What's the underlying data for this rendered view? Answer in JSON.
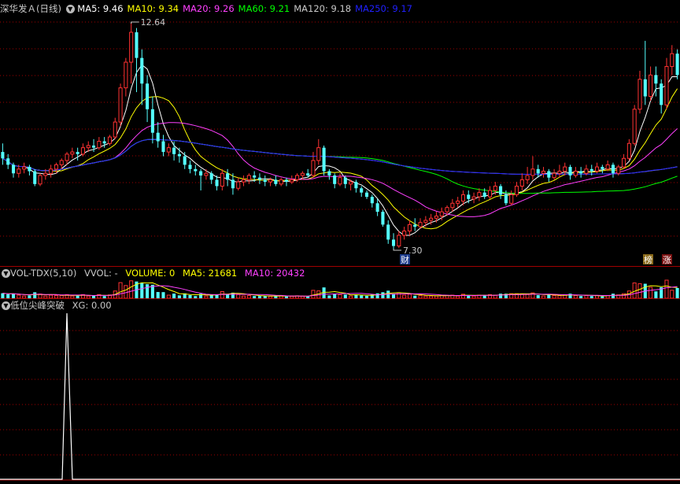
{
  "main_panel": {
    "title": "深华发Ａ(日线)",
    "ma_labels": [
      {
        "text": "MA5: 9.46",
        "color": "#ffffff"
      },
      {
        "text": "MA10: 9.34",
        "color": "#ffff00"
      },
      {
        "text": "MA20: 9.26",
        "color": "#ff40ff"
      },
      {
        "text": "MA60: 9.21",
        "color": "#00ff00"
      },
      {
        "text": "MA120: 9.18",
        "color": "#c8c8c8"
      },
      {
        "text": "MA250: 9.17",
        "color": "#2020ff"
      }
    ],
    "high_label": "12.64",
    "low_label": "7.30",
    "badge_cai": "财",
    "badge_bang": "榜",
    "badge_zhang": "涨"
  },
  "volume_panel": {
    "name": "VOL-TDX(5,10)",
    "vvol": "VVOL: -",
    "volume": "VOLUME: 0",
    "ma5": "MA5: 21681",
    "ma10": "MA10: 20432"
  },
  "signal_panel": {
    "name": "低位尖峰突破",
    "xg": "XG: 0.00"
  },
  "colors": {
    "up": "#ff3232",
    "down": "#54ffff",
    "grid": "#a00000",
    "ma5": "#ffffff",
    "ma10": "#ffff00",
    "ma20": "#ff40ff",
    "ma60": "#00ff00",
    "ma120": "#c8c8c8",
    "ma250": "#2020ff"
  },
  "candles": [
    [
      9.6,
      9.45,
      9.8,
      9.3
    ],
    [
      9.45,
      9.3,
      9.55,
      9.2
    ],
    [
      9.3,
      9.1,
      9.35,
      9.0
    ],
    [
      9.1,
      9.2,
      9.3,
      9.0
    ],
    [
      9.2,
      9.25,
      9.35,
      9.1
    ],
    [
      9.25,
      9.15,
      9.3,
      9.05
    ],
    [
      9.15,
      8.85,
      9.2,
      8.8
    ],
    [
      8.85,
      9.05,
      9.1,
      8.8
    ],
    [
      9.05,
      9.1,
      9.2,
      8.95
    ],
    [
      9.1,
      9.2,
      9.3,
      9.0
    ],
    [
      9.2,
      9.3,
      9.35,
      9.1
    ],
    [
      9.3,
      9.4,
      9.45,
      9.2
    ],
    [
      9.4,
      9.55,
      9.6,
      9.3
    ],
    [
      9.55,
      9.6,
      9.7,
      9.45
    ],
    [
      9.6,
      9.55,
      9.7,
      9.4
    ],
    [
      9.55,
      9.7,
      9.8,
      9.5
    ],
    [
      9.7,
      9.75,
      9.85,
      9.6
    ],
    [
      9.75,
      9.7,
      9.9,
      9.6
    ],
    [
      9.7,
      9.85,
      9.95,
      9.65
    ],
    [
      9.85,
      9.8,
      9.95,
      9.7
    ],
    [
      9.8,
      9.95,
      10.0,
      9.75
    ],
    [
      9.95,
      10.3,
      10.4,
      9.9
    ],
    [
      10.3,
      11.1,
      11.2,
      10.2
    ],
    [
      11.1,
      11.7,
      11.8,
      10.9
    ],
    [
      11.7,
      12.4,
      12.64,
      11.2
    ],
    [
      12.4,
      11.8,
      12.5,
      11.0
    ],
    [
      11.8,
      11.2,
      12.0,
      10.7
    ],
    [
      11.2,
      10.6,
      11.4,
      10.3
    ],
    [
      10.6,
      10.05,
      10.9,
      9.8
    ],
    [
      10.05,
      9.85,
      10.3,
      9.7
    ],
    [
      9.85,
      9.6,
      10.0,
      9.5
    ],
    [
      9.6,
      9.7,
      9.8,
      9.5
    ],
    [
      9.7,
      9.55,
      9.85,
      9.4
    ],
    [
      9.55,
      9.5,
      9.7,
      9.35
    ],
    [
      9.5,
      9.3,
      9.6,
      9.2
    ],
    [
      9.3,
      9.2,
      9.4,
      9.1
    ],
    [
      9.2,
      9.15,
      9.3,
      9.05
    ],
    [
      9.15,
      9.05,
      9.2,
      8.7
    ],
    [
      9.05,
      9.1,
      9.2,
      8.95
    ],
    [
      9.1,
      8.95,
      9.15,
      8.85
    ],
    [
      8.95,
      8.8,
      9.05,
      8.7
    ],
    [
      8.8,
      9.1,
      9.2,
      8.7
    ],
    [
      9.1,
      8.95,
      9.2,
      8.8
    ],
    [
      8.95,
      8.75,
      9.1,
      8.6
    ],
    [
      8.75,
      8.9,
      9.0,
      8.7
    ],
    [
      8.9,
      8.95,
      9.05,
      8.8
    ],
    [
      8.95,
      9.05,
      9.1,
      8.85
    ],
    [
      9.05,
      9.0,
      9.15,
      8.9
    ],
    [
      9.0,
      8.95,
      9.1,
      8.85
    ],
    [
      8.95,
      8.9,
      9.05,
      8.8
    ],
    [
      8.9,
      8.95,
      9.0,
      8.8
    ],
    [
      8.95,
      8.85,
      9.05,
      8.8
    ],
    [
      8.85,
      8.95,
      9.0,
      8.8
    ],
    [
      8.95,
      8.9,
      9.0,
      8.8
    ],
    [
      8.9,
      8.95,
      9.05,
      8.85
    ],
    [
      8.95,
      9.05,
      9.1,
      8.9
    ],
    [
      9.05,
      9.1,
      9.15,
      8.95
    ],
    [
      9.1,
      9.05,
      9.2,
      9.0
    ],
    [
      9.05,
      9.4,
      9.6,
      9.0
    ],
    [
      9.4,
      9.7,
      9.9,
      9.3
    ],
    [
      9.7,
      9.15,
      9.75,
      9.05
    ],
    [
      9.15,
      9.05,
      9.2,
      8.95
    ],
    [
      9.05,
      8.85,
      9.1,
      8.75
    ],
    [
      8.85,
      9.0,
      9.1,
      8.8
    ],
    [
      9.0,
      8.85,
      9.05,
      8.75
    ],
    [
      8.85,
      8.9,
      8.95,
      8.7
    ],
    [
      8.9,
      8.75,
      8.95,
      8.65
    ],
    [
      8.75,
      8.65,
      8.8,
      8.55
    ],
    [
      8.65,
      8.55,
      8.7,
      8.5
    ],
    [
      8.55,
      8.4,
      8.6,
      8.3
    ],
    [
      8.4,
      8.2,
      8.5,
      8.1
    ],
    [
      8.2,
      7.9,
      8.25,
      7.85
    ],
    [
      7.9,
      7.55,
      8.0,
      7.45
    ],
    [
      7.55,
      7.4,
      7.7,
      7.3
    ],
    [
      7.4,
      7.65,
      7.75,
      7.35
    ],
    [
      7.65,
      7.75,
      7.85,
      7.55
    ],
    [
      7.75,
      7.9,
      8.0,
      7.65
    ],
    [
      7.9,
      7.85,
      8.05,
      7.75
    ],
    [
      7.85,
      7.95,
      8.05,
      7.8
    ],
    [
      7.95,
      8.0,
      8.1,
      7.85
    ],
    [
      8.0,
      8.05,
      8.15,
      7.9
    ],
    [
      8.05,
      8.1,
      8.2,
      7.95
    ],
    [
      8.1,
      8.2,
      8.3,
      8.0
    ],
    [
      8.2,
      8.3,
      8.35,
      8.1
    ],
    [
      8.3,
      8.4,
      8.5,
      8.2
    ],
    [
      8.4,
      8.45,
      8.55,
      8.3
    ],
    [
      8.45,
      8.6,
      8.7,
      8.35
    ],
    [
      8.6,
      8.5,
      8.7,
      8.4
    ],
    [
      8.5,
      8.55,
      8.65,
      8.4
    ],
    [
      8.55,
      8.65,
      8.75,
      8.45
    ],
    [
      8.65,
      8.55,
      8.75,
      8.5
    ],
    [
      8.55,
      8.7,
      8.8,
      8.5
    ],
    [
      8.7,
      8.8,
      8.9,
      8.6
    ],
    [
      8.8,
      8.6,
      8.85,
      8.5
    ],
    [
      8.6,
      8.4,
      8.7,
      8.35
    ],
    [
      8.4,
      8.6,
      8.7,
      8.35
    ],
    [
      8.6,
      8.8,
      8.9,
      8.55
    ],
    [
      8.8,
      8.95,
      9.1,
      8.7
    ],
    [
      8.95,
      9.05,
      9.25,
      8.85
    ],
    [
      9.05,
      9.2,
      9.5,
      8.95
    ],
    [
      9.2,
      9.1,
      9.3,
      9.0
    ],
    [
      9.1,
      9.15,
      9.25,
      9.0
    ],
    [
      9.15,
      9.0,
      9.2,
      8.9
    ],
    [
      9.0,
      9.1,
      9.2,
      8.95
    ],
    [
      9.1,
      9.15,
      9.3,
      9.0
    ],
    [
      9.15,
      9.25,
      9.35,
      9.05
    ],
    [
      9.25,
      9.05,
      9.3,
      8.95
    ],
    [
      9.05,
      9.15,
      9.25,
      9.0
    ],
    [
      9.15,
      9.1,
      9.25,
      9.0
    ],
    [
      9.1,
      9.2,
      9.3,
      9.05
    ],
    [
      9.2,
      9.15,
      9.3,
      9.05
    ],
    [
      9.15,
      9.25,
      9.35,
      9.1
    ],
    [
      9.25,
      9.2,
      9.3,
      9.1
    ],
    [
      9.2,
      9.3,
      9.4,
      9.15
    ],
    [
      9.3,
      9.1,
      9.35,
      9.0
    ],
    [
      9.1,
      9.25,
      9.3,
      9.05
    ],
    [
      9.25,
      9.45,
      9.55,
      9.2
    ],
    [
      9.45,
      9.8,
      9.9,
      9.4
    ],
    [
      9.8,
      10.6,
      10.7,
      9.75
    ],
    [
      10.6,
      11.3,
      11.5,
      10.5
    ],
    [
      11.3,
      10.9,
      12.2,
      10.7
    ],
    [
      10.9,
      11.4,
      11.6,
      10.8
    ],
    [
      11.4,
      11.2,
      11.6,
      10.9
    ],
    [
      11.2,
      10.7,
      11.3,
      10.5
    ],
    [
      10.7,
      11.6,
      11.8,
      10.6
    ],
    [
      11.6,
      11.9,
      12.1,
      11.4
    ],
    [
      11.9,
      11.4,
      12.0,
      11.3
    ]
  ]
}
